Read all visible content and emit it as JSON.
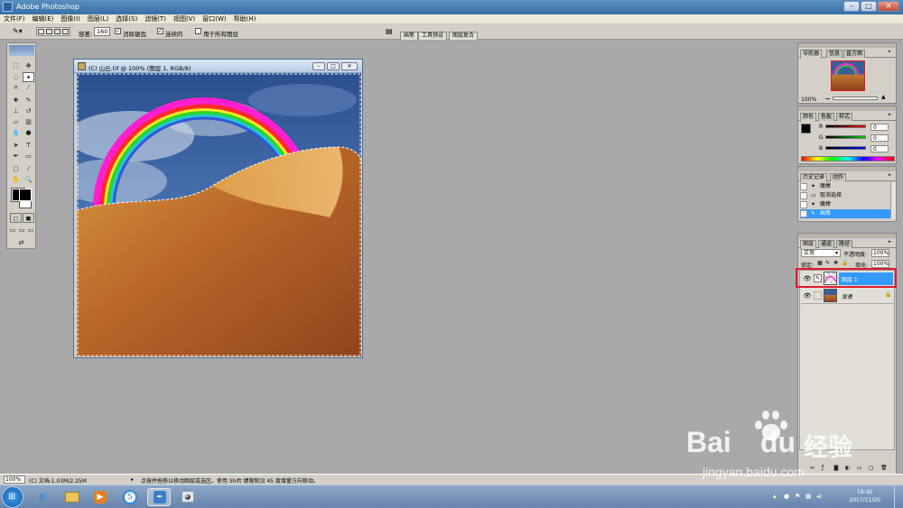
{
  "window": {
    "title": "Adobe Photoshop"
  },
  "menu": [
    "文件(F)",
    "编辑(E)",
    "图像(I)",
    "图层(L)",
    "选择(S)",
    "滤镜(T)",
    "视图(V)",
    "窗口(W)",
    "帮助(H)"
  ],
  "options": {
    "tolerance_label": "容差:",
    "tolerance_value": "160",
    "antialias_label": "消除锯齿",
    "contiguous_label": "连续的",
    "all_layers_label": "用于所有图层",
    "tabs": [
      "画笔",
      "工具预设",
      "图层复合"
    ]
  },
  "document": {
    "title": "(C) 山丘.tif @ 100% (图层 1, RGB/8)"
  },
  "navigator": {
    "tabs": [
      "导航器",
      "信息",
      "直方图"
    ],
    "zoom": "100%"
  },
  "color": {
    "tabs": [
      "颜色",
      "色板",
      "样式"
    ],
    "channels": [
      {
        "label": "R",
        "value": "0",
        "color": "#e11d1d"
      },
      {
        "label": "G",
        "value": "0",
        "color": "#1aa31a"
      },
      {
        "label": "B",
        "value": "0",
        "color": "#1f2bd0"
      }
    ]
  },
  "history": {
    "tabs": [
      "历史记录",
      "动作"
    ],
    "items": [
      "魔棒",
      "取消选择",
      "魔棒",
      "画笔"
    ]
  },
  "layers": {
    "tabs": [
      "图层",
      "通道",
      "路径"
    ],
    "blend_mode": "正常",
    "opacity_label": "不透明度:",
    "opacity_value": "100%",
    "lock_label": "锁定:",
    "fill_label": "填充:",
    "fill_value": "100%",
    "items": [
      {
        "name": "图层 1",
        "selected": true
      },
      {
        "name": "背景",
        "selected": false
      }
    ]
  },
  "status": {
    "zoom": "100%",
    "doc_info": "(C) 文档:1.03M/2.25M",
    "hint": "点按并拖移以移动图层或选区。使用 Shift 键限制沿 45 度增量方向移动。"
  },
  "taskbar": {
    "time": "19:42",
    "date": "2017/11/20"
  },
  "watermark": {
    "brand": "Bai",
    "brand2": "du",
    "cn": "经验",
    "url": "jingyan.baidu.com"
  },
  "colors": {
    "selection_highlight": "#3399ff",
    "annotation_box": "#e21b2c"
  }
}
